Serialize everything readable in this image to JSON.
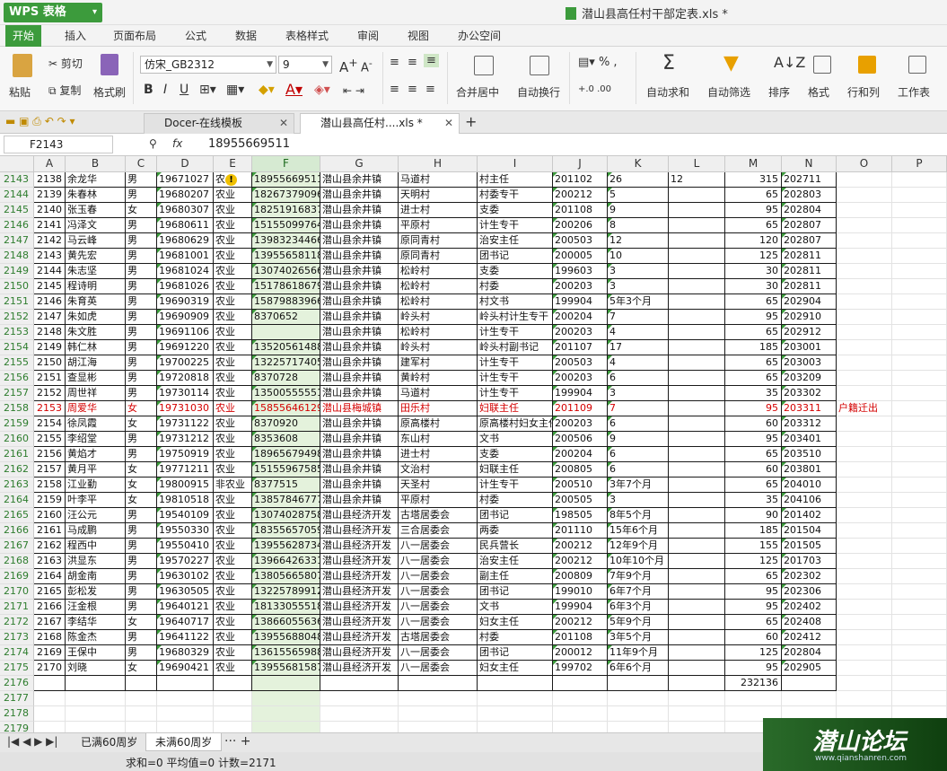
{
  "app": {
    "name": "WPS 表格",
    "doc_title": "潜山县高任村干部定表.xls *"
  },
  "menu": [
    "开始",
    "插入",
    "页面布局",
    "公式",
    "数据",
    "表格样式",
    "审阅",
    "视图",
    "办公空间"
  ],
  "ribbon": {
    "paste": "粘贴",
    "cut": "剪切",
    "copy": "复制",
    "format_painter": "格式刷",
    "font": "仿宋_GB2312",
    "size": "9",
    "bold": "B",
    "italic": "I",
    "underline": "U",
    "merge": "合并居中",
    "wrap": "自动换行",
    "autosum": "自动求和",
    "autofilter": "自动筛选",
    "sort": "排序",
    "format": "格式",
    "rowcol": "行和列",
    "sheet": "工作表"
  },
  "tabs": [
    {
      "label": "Docer-在线模板"
    },
    {
      "label": "潜山县高任村....xls *"
    }
  ],
  "formula": {
    "namebox": "F2143",
    "fx": "fx",
    "value": "18955669511"
  },
  "columns": [
    "A",
    "B",
    "C",
    "D",
    "E",
    "F",
    "G",
    "H",
    "I",
    "J",
    "K",
    "L",
    "M",
    "N",
    "O",
    "P"
  ],
  "rows": [
    {
      "r": "2143",
      "c": [
        "2138",
        "余龙华",
        "男",
        "19671027",
        "农",
        "18955669511",
        "潜山县余井镇",
        "马道村",
        "村主任",
        "201102",
        "26",
        "12",
        "315",
        "202711",
        "",
        ""
      ]
    },
    {
      "r": "2144",
      "c": [
        "2139",
        "朱春林",
        "男",
        "19680207",
        "农业",
        "18267379096",
        "潜山县余井镇",
        "天明村",
        "村委专干",
        "200212",
        "5",
        "",
        "65",
        "202803",
        "",
        ""
      ]
    },
    {
      "r": "2145",
      "c": [
        "2140",
        "张玉春",
        "女",
        "19680307",
        "农业",
        "18251916837",
        "潜山县余井镇",
        "进士村",
        "支委",
        "201108",
        "9",
        "",
        "95",
        "202804",
        "",
        ""
      ]
    },
    {
      "r": "2146",
      "c": [
        "2141",
        "冯泽文",
        "男",
        "19680611",
        "农业",
        "15155099764",
        "潜山县余井镇",
        "平原村",
        "计生专干",
        "200206",
        "8",
        "",
        "65",
        "202807",
        "",
        ""
      ]
    },
    {
      "r": "2147",
      "c": [
        "2142",
        "马云峰",
        "男",
        "19680629",
        "农业",
        "13983234466",
        "潜山县余井镇",
        "原同青村",
        "治安主任",
        "200503",
        "12",
        "",
        "120",
        "202807",
        "",
        ""
      ]
    },
    {
      "r": "2148",
      "c": [
        "2143",
        "黄先宏",
        "男",
        "19681001",
        "农业",
        "13955658118",
        "潜山县余井镇",
        "原同青村",
        "团书记",
        "200005",
        "10",
        "",
        "125",
        "202811",
        "",
        ""
      ]
    },
    {
      "r": "2149",
      "c": [
        "2144",
        "朱志坚",
        "男",
        "19681024",
        "农业",
        "13074026566",
        "潜山县余井镇",
        "松岭村",
        "支委",
        "199603",
        "3",
        "",
        "30",
        "202811",
        "",
        ""
      ]
    },
    {
      "r": "2150",
      "c": [
        "2145",
        "程诗明",
        "男",
        "19681026",
        "农业",
        "15178618679",
        "潜山县余井镇",
        "松岭村",
        "村委",
        "200203",
        "3",
        "",
        "30",
        "202811",
        "",
        ""
      ]
    },
    {
      "r": "2151",
      "c": [
        "2146",
        "朱育英",
        "男",
        "19690319",
        "农业",
        "15879883966",
        "潜山县余井镇",
        "松岭村",
        "村文书",
        "199904",
        "5年3个月",
        "",
        "65",
        "202904",
        "",
        ""
      ]
    },
    {
      "r": "2152",
      "c": [
        "2147",
        "朱如虎",
        "男",
        "19690909",
        "农业",
        "8370652",
        "潜山县余井镇",
        "岭头村",
        "岭头村计生专干",
        "200204",
        "7",
        "",
        "95",
        "202910",
        "",
        ""
      ]
    },
    {
      "r": "2153",
      "c": [
        "2148",
        "朱文胜",
        "男",
        "19691106",
        "农业",
        "",
        "潜山县余井镇",
        "松岭村",
        "计生专干",
        "200203",
        "4",
        "",
        "65",
        "202912",
        "",
        ""
      ]
    },
    {
      "r": "2154",
      "c": [
        "2149",
        "韩仁林",
        "男",
        "19691220",
        "农业",
        "13520561488",
        "潜山县余井镇",
        "岭头村",
        "岭头村副书记",
        "201107",
        "17",
        "",
        "185",
        "203001",
        "",
        ""
      ]
    },
    {
      "r": "2155",
      "c": [
        "2150",
        "胡江海",
        "男",
        "19700225",
        "农业",
        "13225717405",
        "潜山县余井镇",
        "建军村",
        "计生专干",
        "200503",
        "4",
        "",
        "65",
        "203003",
        "",
        ""
      ]
    },
    {
      "r": "2156",
      "c": [
        "2151",
        "查显彬",
        "男",
        "19720818",
        "农业",
        "8370728",
        "潜山县余井镇",
        "黄岭村",
        "计生专干",
        "200203",
        "6",
        "",
        "65",
        "203209",
        "",
        ""
      ]
    },
    {
      "r": "2157",
      "c": [
        "2152",
        "周世祥",
        "男",
        "19730114",
        "农业",
        "13500555551",
        "潜山县余井镇",
        "马道村",
        "计生专干",
        "199904",
        "3",
        "",
        "35",
        "203302",
        "",
        ""
      ]
    },
    {
      "r": "2158",
      "c": [
        "2153",
        "周爱华",
        "女",
        "19731030",
        "农业",
        "15855646129",
        "潜山县梅城镇",
        "田乐村",
        "妇联主任",
        "201109",
        "7",
        "",
        "95",
        "203311",
        "户籍迁出",
        ""
      ],
      "red": true
    },
    {
      "r": "2159",
      "c": [
        "2154",
        "徐凤霞",
        "女",
        "19731122",
        "农业",
        "8370920",
        "潜山县余井镇",
        "原高楼村",
        "原高楼村妇女主任",
        "200203",
        "6",
        "",
        "60",
        "203312",
        "",
        ""
      ]
    },
    {
      "r": "2160",
      "c": [
        "2155",
        "李绍堂",
        "男",
        "19731212",
        "农业",
        "8353608",
        "潜山县余井镇",
        "东山村",
        "文书",
        "200506",
        "9",
        "",
        "95",
        "203401",
        "",
        ""
      ]
    },
    {
      "r": "2161",
      "c": [
        "2156",
        "黄焰才",
        "男",
        "19750919",
        "农业",
        "18965679498",
        "潜山县余井镇",
        "进士村",
        "支委",
        "200204",
        "6",
        "",
        "65",
        "203510",
        "",
        ""
      ]
    },
    {
      "r": "2162",
      "c": [
        "2157",
        "黄月平",
        "女",
        "19771211",
        "农业",
        "15155967585",
        "潜山县余井镇",
        "文治村",
        "妇联主任",
        "200805",
        "6",
        "",
        "60",
        "203801",
        "",
        ""
      ]
    },
    {
      "r": "2163",
      "c": [
        "2158",
        "江业勤",
        "女",
        "19800915",
        "非农业",
        "8377515",
        "潜山县余井镇",
        "天圣村",
        "计生专干",
        "200510",
        "3年7个月",
        "",
        "65",
        "204010",
        "",
        ""
      ]
    },
    {
      "r": "2164",
      "c": [
        "2159",
        "叶李平",
        "女",
        "19810518",
        "农业",
        "13857846777",
        "潜山县余井镇",
        "平原村",
        "村委",
        "200505",
        "3",
        "",
        "35",
        "204106",
        "",
        ""
      ]
    },
    {
      "r": "2165",
      "c": [
        "2160",
        "汪公元",
        "男",
        "19540109",
        "农业",
        "13074028758",
        "潜山县经济开发",
        "古塔居委会",
        "团书记",
        "198505",
        "8年5个月",
        "",
        "90",
        "201402",
        "",
        ""
      ]
    },
    {
      "r": "2166",
      "c": [
        "2161",
        "马成鹏",
        "男",
        "19550330",
        "农业",
        "18355657059",
        "潜山县经济开发",
        "三合居委会",
        "两委",
        "201110",
        "15年6个月",
        "",
        "185",
        "201504",
        "",
        ""
      ]
    },
    {
      "r": "2167",
      "c": [
        "2162",
        "程西中",
        "男",
        "19550410",
        "农业",
        "13955628734",
        "潜山县经济开发",
        "八一居委会",
        "民兵营长",
        "200212",
        "12年9个月",
        "",
        "155",
        "201505",
        "",
        ""
      ]
    },
    {
      "r": "2168",
      "c": [
        "2163",
        "洪显东",
        "男",
        "19570227",
        "农业",
        "13966426331",
        "潜山县经济开发",
        "八一居委会",
        "治安主任",
        "200212",
        "10年10个月",
        "",
        "125",
        "201703",
        "",
        ""
      ]
    },
    {
      "r": "2169",
      "c": [
        "2164",
        "胡金南",
        "男",
        "19630102",
        "农业",
        "13805665807",
        "潜山县经济开发",
        "八一居委会",
        "副主任",
        "200809",
        "7年9个月",
        "",
        "65",
        "202302",
        "",
        ""
      ]
    },
    {
      "r": "2170",
      "c": [
        "2165",
        "彭松发",
        "男",
        "19630505",
        "农业",
        "13225789912",
        "潜山县经济开发",
        "八一居委会",
        "团书记",
        "199010",
        "6年7个月",
        "",
        "95",
        "202306",
        "",
        ""
      ]
    },
    {
      "r": "2171",
      "c": [
        "2166",
        "汪金根",
        "男",
        "19640121",
        "农业",
        "18133055518",
        "潜山县经济开发",
        "八一居委会",
        "文书",
        "199904",
        "6年3个月",
        "",
        "95",
        "202402",
        "",
        ""
      ]
    },
    {
      "r": "2172",
      "c": [
        "2167",
        "李结华",
        "女",
        "19640717",
        "农业",
        "13866055636",
        "潜山县经济开发",
        "八一居委会",
        "妇女主任",
        "200212",
        "5年9个月",
        "",
        "65",
        "202408",
        "",
        ""
      ]
    },
    {
      "r": "2173",
      "c": [
        "2168",
        "陈金杰",
        "男",
        "19641122",
        "农业",
        "13955688048",
        "潜山县经济开发",
        "古塔居委会",
        "村委",
        "201108",
        "3年5个月",
        "",
        "60",
        "202412",
        "",
        ""
      ]
    },
    {
      "r": "2174",
      "c": [
        "2169",
        "王保中",
        "男",
        "19680329",
        "农业",
        "13615565988",
        "潜山县经济开发",
        "八一居委会",
        "团书记",
        "200012",
        "11年9个月",
        "",
        "125",
        "202804",
        "",
        ""
      ]
    },
    {
      "r": "2175",
      "c": [
        "2170",
        "刘晓",
        "女",
        "19690421",
        "农业",
        "13955681587",
        "潜山县经济开发",
        "八一居委会",
        "妇女主任",
        "199702",
        "6年6个月",
        "",
        "95",
        "202905",
        "",
        ""
      ]
    },
    {
      "r": "2176",
      "c": [
        "",
        "",
        "",
        "",
        "",
        "",
        "",
        "",
        "",
        "",
        "",
        "",
        "232136",
        "",
        "",
        ""
      ]
    },
    {
      "r": "2177",
      "c": [
        "",
        "",
        "",
        "",
        "",
        "",
        "",
        "",
        "",
        "",
        "",
        "",
        "",
        "",
        "",
        ""
      ]
    },
    {
      "r": "2178",
      "c": [
        "",
        "",
        "",
        "",
        "",
        "",
        "",
        "",
        "",
        "",
        "",
        "",
        "",
        "",
        "",
        ""
      ]
    },
    {
      "r": "2179",
      "c": [
        "",
        "",
        "",
        "",
        "",
        "",
        "",
        "",
        "",
        "",
        "",
        "",
        "",
        "",
        "",
        ""
      ]
    }
  ],
  "sheets": [
    "已满60周岁",
    "未满60周岁"
  ],
  "status": "求和=0   平均值=0   计数=2171",
  "watermark": {
    "logo": "潜山论坛",
    "url": "www.qianshanren.com"
  },
  "colors": {
    "accent": "#3c9b3c",
    "red_row": "#d40000",
    "selected_col": "#e4f2dc"
  }
}
